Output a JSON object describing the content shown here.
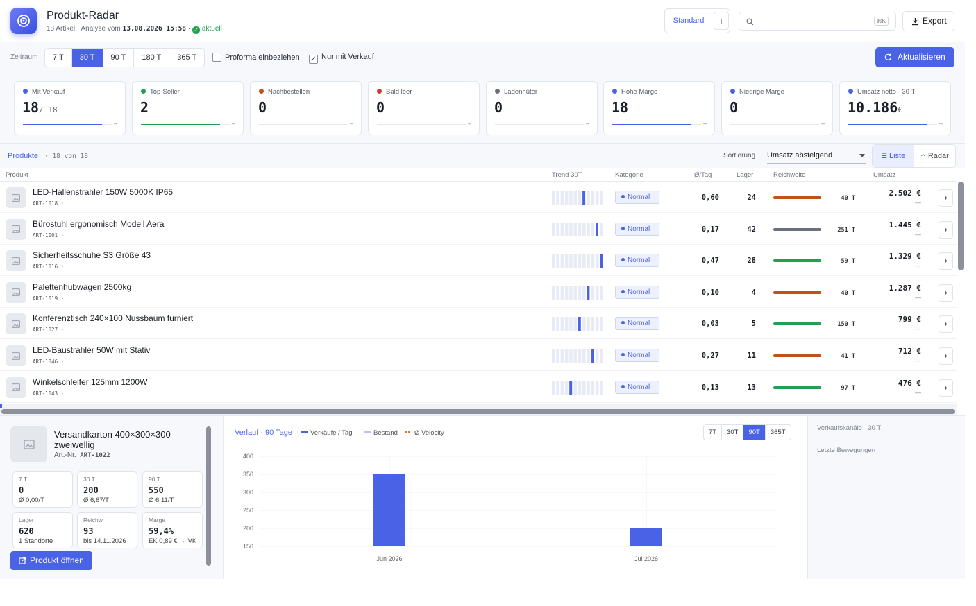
{
  "header": {
    "title": "Produkt-Radar",
    "count_text": "18 Artikel",
    "analysis_prefix": "Analyse vom",
    "analysis_date": "13.08.2026 15:58",
    "status": "aktuell",
    "preset_label": "Standard",
    "preset_add": "+",
    "search_placeholder": "",
    "search_shortcut": "⌘K",
    "export_label": "Export"
  },
  "filters": {
    "label": "Zeitraum",
    "periods": [
      "7 T",
      "30 T",
      "90 T",
      "180 T",
      "365 T"
    ],
    "active_period": "30 T",
    "proforma_label": "Proforma einbeziehen",
    "proforma_checked": false,
    "only_sold_label": "Nur mit Verkauf",
    "only_sold_checked": true,
    "refresh_label": "Aktualisieren"
  },
  "kpis": [
    {
      "label": "Mit Verkauf",
      "value": "18",
      "suffix": "/ 18",
      "color": "#4a63e6",
      "fill": 1.0,
      "dash": "–"
    },
    {
      "label": "Top-Seller",
      "value": "2",
      "suffix": "",
      "color": "#22a04f",
      "fill": 1.0,
      "dash": "–"
    },
    {
      "label": "Nachbestellen",
      "value": "0",
      "suffix": "",
      "color": "#c0521a",
      "fill": 0,
      "dash": "–"
    },
    {
      "label": "Bald leer",
      "value": "0",
      "suffix": "",
      "color": "#d63a2f",
      "fill": 0,
      "dash": "–"
    },
    {
      "label": "Ladenhüter",
      "value": "0",
      "suffix": "",
      "color": "#6a7080",
      "fill": 0,
      "dash": "–"
    },
    {
      "label": "Hohe Marge",
      "value": "18",
      "suffix": "",
      "color": "#4a63e6",
      "fill": 1.0,
      "dash": "–"
    },
    {
      "label": "Niedrige Marge",
      "value": "0",
      "suffix": "",
      "color": "#4a63e6",
      "fill": 0,
      "dash": "–"
    },
    {
      "label": "Umsatz netto · 30 T",
      "value": "10.186",
      "suffix": "€",
      "color": "#4a63e6",
      "fill": 1.0,
      "dash": "–"
    }
  ],
  "products_header": {
    "title": "Produkte",
    "count": "· 18 von 18",
    "sort_label": "Sortierung",
    "sort_value": "Umsatz absteigend",
    "view_list": "Liste",
    "view_radar": "Radar"
  },
  "columns": {
    "product": "Produkt",
    "trend": "Trend 30T",
    "category": "Kategorie",
    "per_day": "Ø/Tag",
    "stock": "Lager",
    "reach": "Reichweite",
    "revenue": "Umsatz"
  },
  "products": [
    {
      "name": "LED-Hallenstrahler 150W 5000K IP65",
      "id": "ART-1018 ·",
      "category": "Normal",
      "per_day": "0,60",
      "stock": "24",
      "reach": "40 T",
      "reach_color": "#c0521a",
      "revenue": "2.502 €",
      "revenue_sub": "—",
      "spike": 7
    },
    {
      "name": "Bürostuhl ergonomisch Modell Aera",
      "id": "ART-1001 ·",
      "category": "Normal",
      "per_day": "0,17",
      "stock": "42",
      "reach": "251 T",
      "reach_color": "#6a7080",
      "revenue": "1.445 €",
      "revenue_sub": "—",
      "spike": 10
    },
    {
      "name": "Sicherheitsschuhe S3 Größe 43",
      "id": "ART-1016 ·",
      "category": "Normal",
      "per_day": "0,47",
      "stock": "28",
      "reach": "59 T",
      "reach_color": "#22a04f",
      "revenue": "1.329 €",
      "revenue_sub": "—",
      "spike": 11
    },
    {
      "name": "Palettenhubwagen 2500kg",
      "id": "ART-1019 ·",
      "category": "Normal",
      "per_day": "0,10",
      "stock": "4",
      "reach": "40 T",
      "reach_color": "#c0521a",
      "revenue": "1.287 €",
      "revenue_sub": "—",
      "spike": 8
    },
    {
      "name": "Konferenztisch 240×100 Nussbaum furniert",
      "id": "ART-1027 ·",
      "category": "Normal",
      "per_day": "0,03",
      "stock": "5",
      "reach": "150 T",
      "reach_color": "#22a04f",
      "revenue": "799 €",
      "revenue_sub": "—",
      "spike": 6
    },
    {
      "name": "LED-Baustrahler 50W mit Stativ",
      "id": "ART-1046 ·",
      "category": "Normal",
      "per_day": "0,27",
      "stock": "11",
      "reach": "41 T",
      "reach_color": "#c0521a",
      "revenue": "712 €",
      "revenue_sub": "—",
      "spike": 9
    },
    {
      "name": "Winkelschleifer 125mm 1200W",
      "id": "ART-1043 ·",
      "category": "Normal",
      "per_day": "0,13",
      "stock": "13",
      "reach": "97 T",
      "reach_color": "#22a04f",
      "revenue": "476 €",
      "revenue_sub": "—",
      "spike": 4
    }
  ],
  "detail": {
    "name": "Versandkarton 400×300×300 zweiwellig",
    "art_label": "Art.-Nr.",
    "art_no": "ART-1022",
    "art_suffix": "·",
    "stats": [
      {
        "label": "7 T",
        "value": "0",
        "unit": "",
        "sub": "Ø 0,00/T"
      },
      {
        "label": "30 T",
        "value": "200",
        "unit": "",
        "sub": "Ø 6,67/T"
      },
      {
        "label": "90 T",
        "value": "550",
        "unit": "",
        "sub": "Ø 6,11/T"
      },
      {
        "label": "Lager",
        "value": "620",
        "unit": "",
        "sub": "1 Standorte"
      },
      {
        "label": "Reichw.",
        "value": "93",
        "unit": "T",
        "sub": "bis 14.11.2026"
      },
      {
        "label": "Marge",
        "value": "59,4%",
        "unit": "",
        "sub": "EK 0,89 € → VK"
      }
    ],
    "open_label": "Produkt öffnen",
    "chart_title": "Verlauf · 90 Tage",
    "legend": [
      {
        "label": "Verkäufe / Tag",
        "color": "#4a63e6"
      },
      {
        "label": "Bestand",
        "color": "#b9c3f5"
      },
      {
        "label": "Ø Velocity",
        "color": "#d9781c"
      }
    ],
    "ranges": [
      "7T",
      "30T",
      "90T",
      "365T"
    ],
    "active_range": "90T",
    "side_channels": "Verkaufskanäle · 30 T",
    "side_moves": "Letzte Bewegungen"
  },
  "chart_data": {
    "type": "bar",
    "title": "Verlauf · 90 Tage",
    "categories": [
      "Jun 2026",
      "Jul 2026"
    ],
    "series": [
      {
        "name": "Verkäufe / Tag",
        "values": [
          350,
          200
        ]
      }
    ],
    "ylim": [
      150,
      400
    ],
    "yticks": [
      150,
      200,
      250,
      300,
      350,
      400
    ],
    "grid": true,
    "legend_position": "top"
  }
}
